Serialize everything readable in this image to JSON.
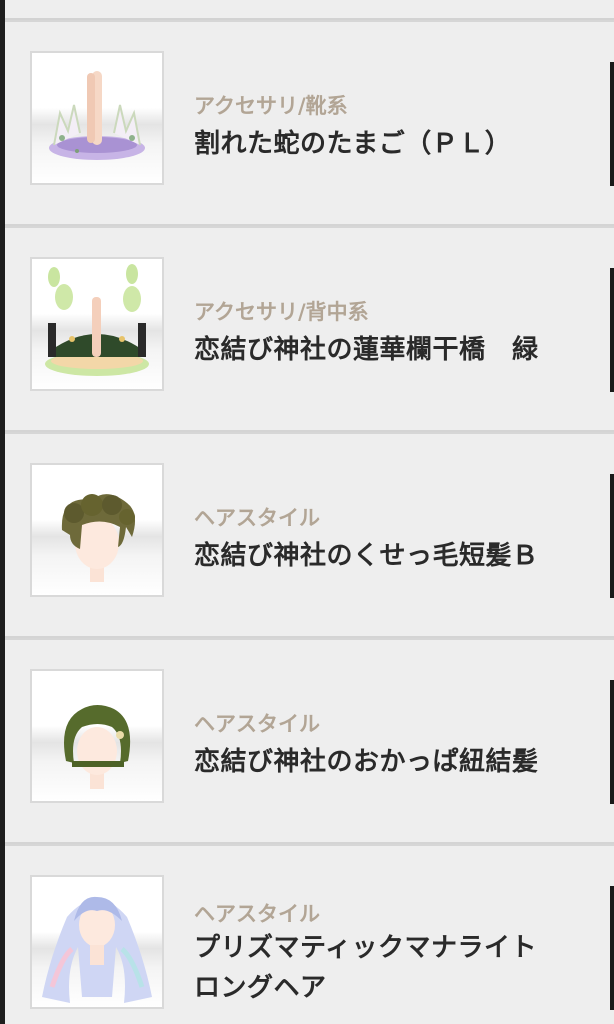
{
  "items": [
    {
      "category": "アクセサリ/靴系",
      "title": "割れた蛇のたまご（ＰＬ）",
      "icon": "cracked-egg-shoes-thumbnail"
    },
    {
      "category": "アクセサリ/背中系",
      "title": "恋結び神社の蓮華欄干橋　緑",
      "icon": "lotus-bridge-thumbnail"
    },
    {
      "category": "ヘアスタイル",
      "title": "恋結び神社のくせっ毛短髪Ｂ",
      "icon": "curly-short-hair-thumbnail"
    },
    {
      "category": "ヘアスタイル",
      "title": "恋結び神社のおかっぱ紐結髪",
      "icon": "bob-cord-hair-thumbnail"
    },
    {
      "category": "ヘアスタイル",
      "title_line1": "プリズマティックマナライト",
      "title_line2": "ロングヘア",
      "icon": "prismatic-long-hair-thumbnail"
    }
  ]
}
